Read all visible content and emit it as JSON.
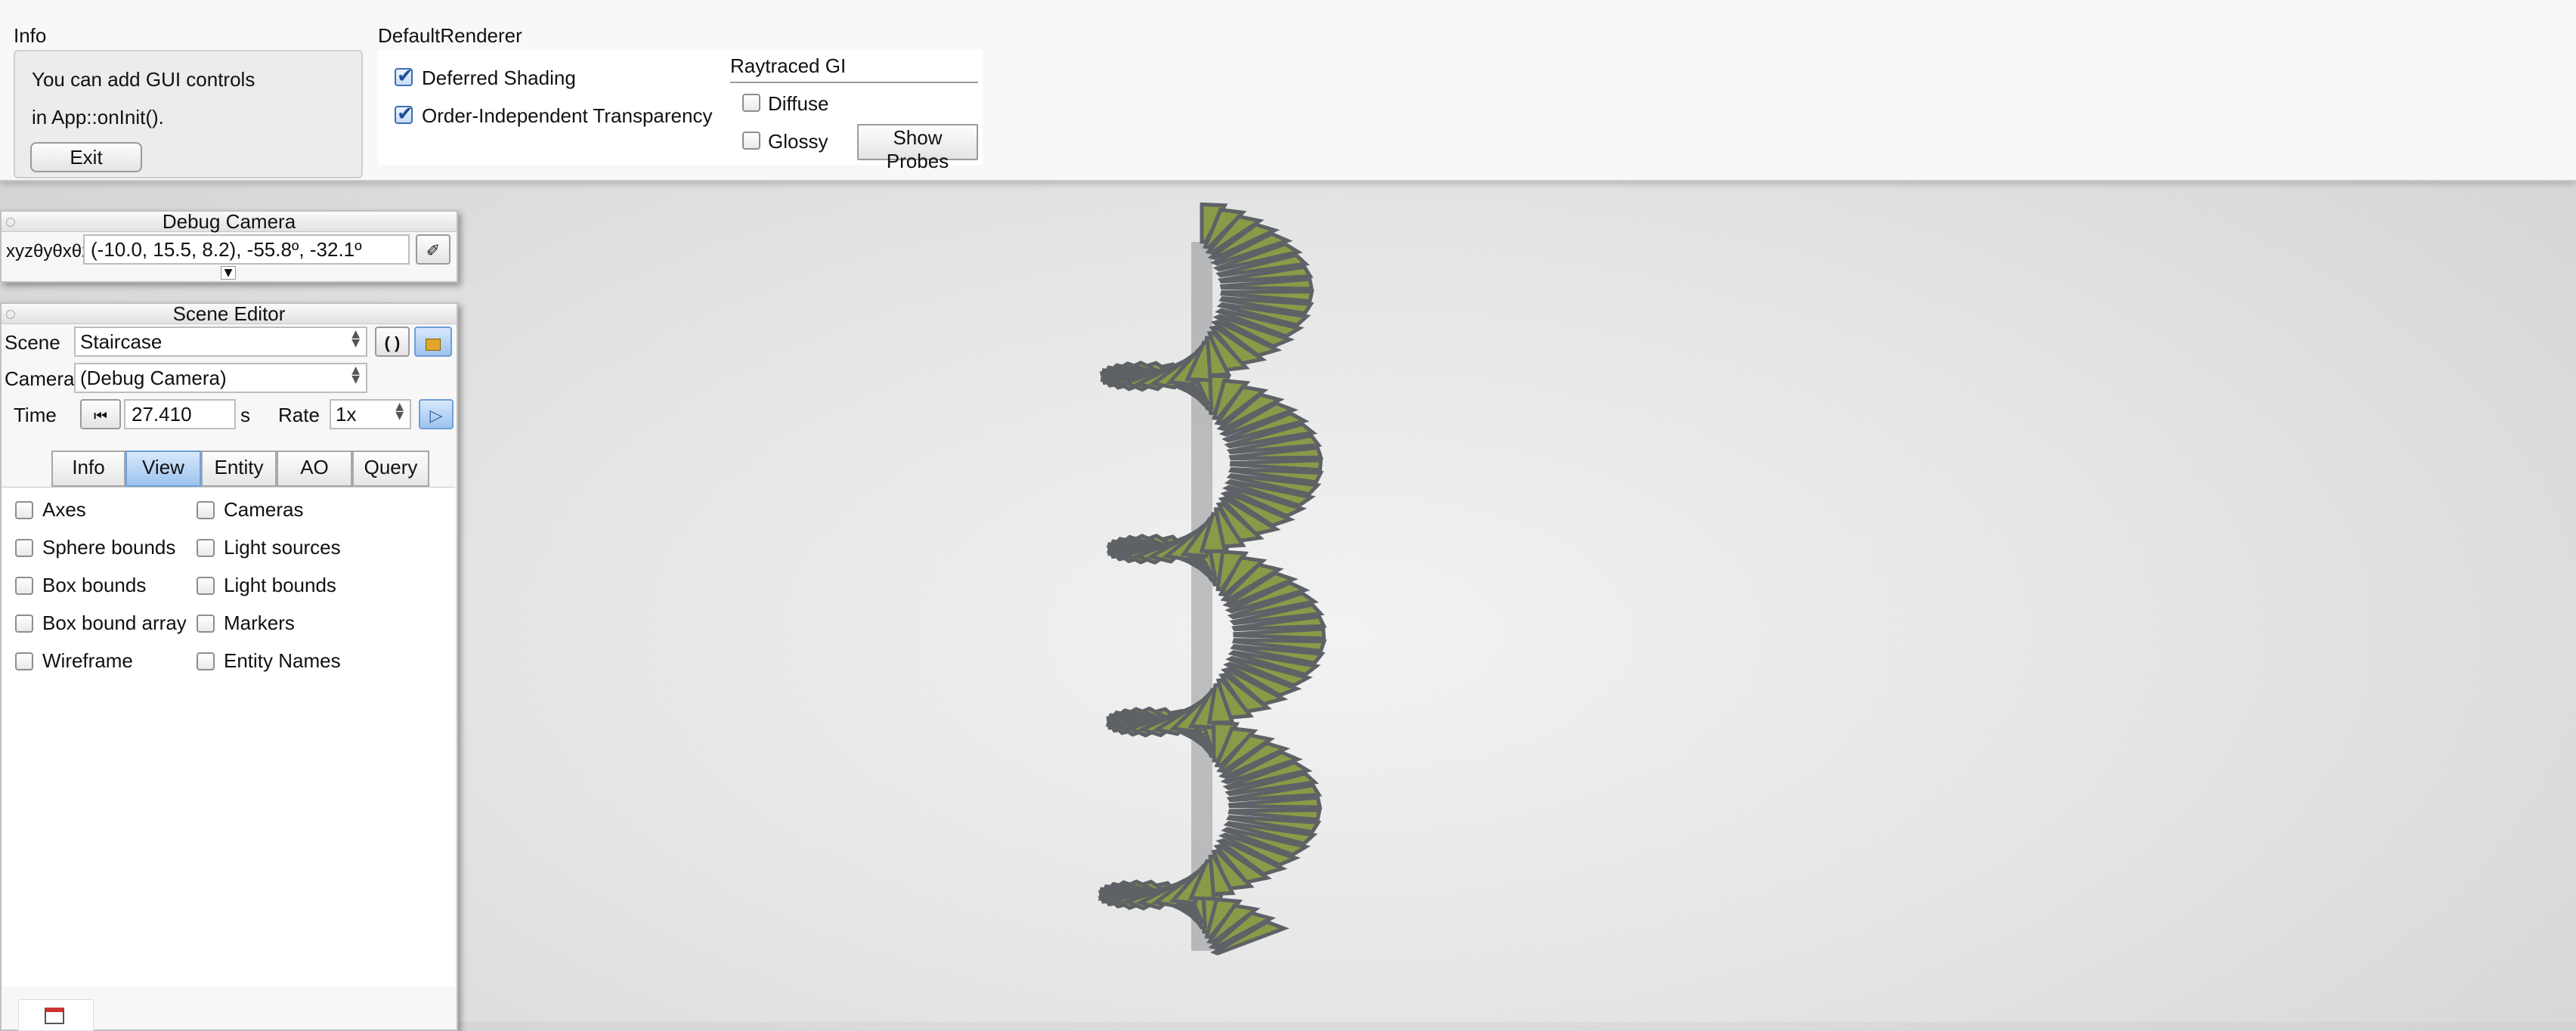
{
  "info": {
    "title": "Info",
    "line1": "You can add GUI controls",
    "line2": "in App::onInit().",
    "exit_label": "Exit"
  },
  "renderer": {
    "title": "DefaultRenderer",
    "deferred_label": "Deferred Shading",
    "deferred_checked": true,
    "oit_label": "Order-Independent Transparency",
    "oit_checked": true,
    "gi_title": "Raytraced GI",
    "diffuse_label": "Diffuse",
    "glossy_label": "Glossy",
    "probes_label": "Show Probes"
  },
  "debug_camera": {
    "title": "Debug Camera",
    "label": "xyzθyθxθz",
    "value": "(-10.0,  15.5,   8.2), -55.8º, -32.1º"
  },
  "scene_editor": {
    "title": "Scene Editor",
    "scene_label": "Scene",
    "scene_value": "Staircase",
    "camera_label": "Camera",
    "camera_value": "(Debug Camera)",
    "time_label": "Time",
    "time_value": "27.410",
    "time_unit": "s",
    "rate_label": "Rate",
    "rate_value": "1x",
    "tabs": [
      "Info",
      "View",
      "Entity",
      "AO",
      "Query"
    ],
    "selected_tab": "View",
    "view_options_left": [
      "Axes",
      "Sphere bounds",
      "Box bounds",
      "Box bound array",
      "Wireframe"
    ],
    "view_options_right": [
      "Cameras",
      "Light sources",
      "Light bounds",
      "Markers",
      "Entity Names"
    ]
  },
  "colors": {
    "accent": "#9cc4ef",
    "stair_tread": "#8a9a48",
    "stair_edge": "#5e6266"
  },
  "icons": [
    "reload-icon",
    "lock-icon",
    "eraser-icon",
    "rewind-icon",
    "play-icon",
    "dropdown-arrow-icon",
    "window-icon"
  ]
}
